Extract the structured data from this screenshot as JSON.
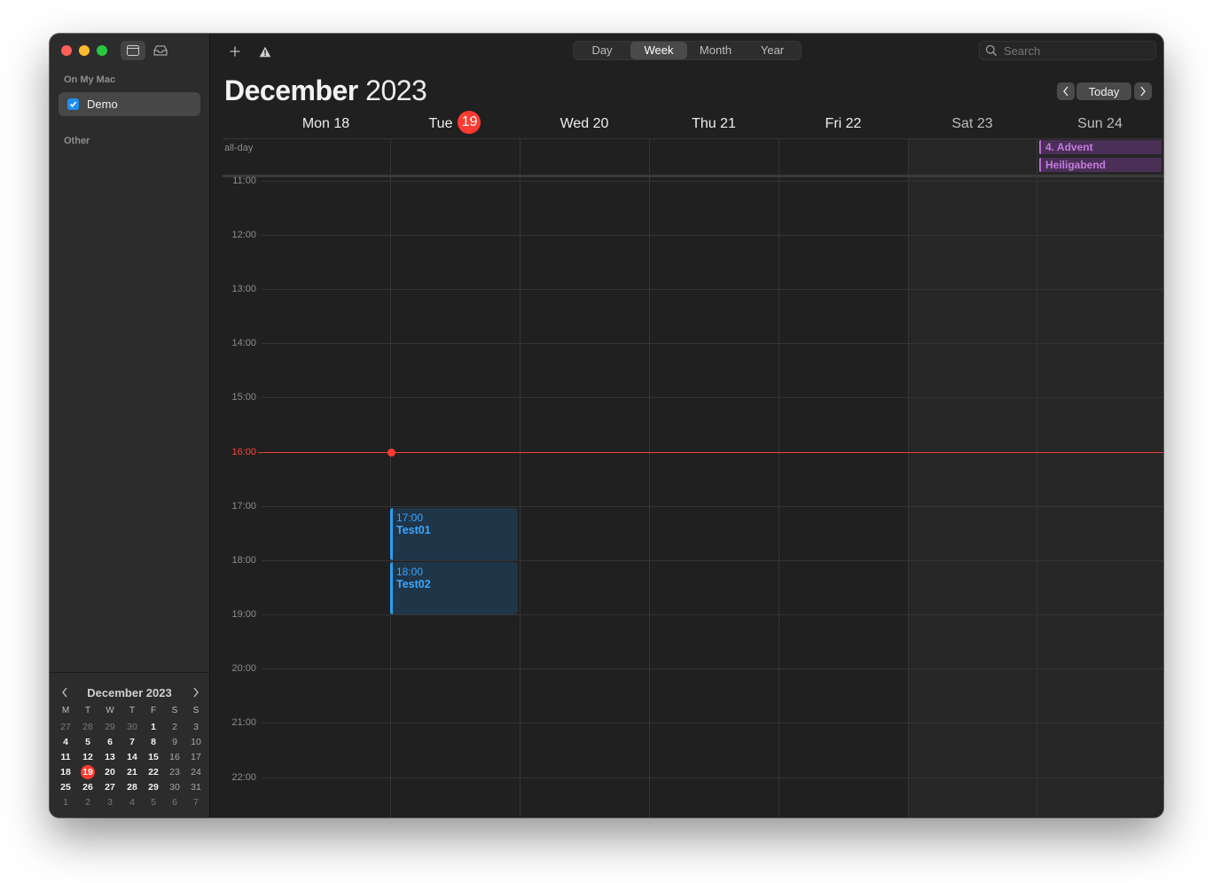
{
  "sidebar": {
    "section_on_my_mac": "On My Mac",
    "calendar_name": "Demo",
    "calendar_checked": true,
    "section_other": "Other"
  },
  "mini_calendar": {
    "title": "December 2023",
    "dow": [
      "M",
      "T",
      "W",
      "T",
      "F",
      "S",
      "S"
    ],
    "weeks": [
      [
        "27",
        "28",
        "29",
        "30",
        "1",
        "2",
        "3"
      ],
      [
        "4",
        "5",
        "6",
        "7",
        "8",
        "9",
        "10"
      ],
      [
        "11",
        "12",
        "13",
        "14",
        "15",
        "16",
        "17"
      ],
      [
        "18",
        "19",
        "20",
        "21",
        "22",
        "23",
        "24"
      ],
      [
        "25",
        "26",
        "27",
        "28",
        "29",
        "30",
        "31"
      ],
      [
        "1",
        "2",
        "3",
        "4",
        "5",
        "6",
        "7"
      ]
    ],
    "today": "19"
  },
  "toolbar": {
    "views": [
      "Day",
      "Week",
      "Month",
      "Year"
    ],
    "active_view": "Week",
    "search_placeholder": "Search",
    "today_label": "Today"
  },
  "header": {
    "month": "December",
    "year": "2023"
  },
  "days": [
    {
      "label": "Mon 18"
    },
    {
      "label": "Tue",
      "number": "19"
    },
    {
      "label": "Wed 20"
    },
    {
      "label": "Thu 21"
    },
    {
      "label": "Fri 22"
    },
    {
      "label": "Sat 23"
    },
    {
      "label": "Sun 24"
    }
  ],
  "allday_label": "all-day",
  "allday_events": [
    {
      "title": "4. Advent",
      "day": "Sun 24"
    },
    {
      "title": "Heiligabend",
      "day": "Sun 24"
    }
  ],
  "hours": [
    "11:00",
    "12:00",
    "13:00",
    "14:00",
    "15:00",
    "16:00",
    "17:00",
    "18:00",
    "19:00",
    "20:00",
    "21:00",
    "22:00"
  ],
  "current_time": "16:00",
  "events": [
    {
      "time": "17:00",
      "title": "Test01",
      "day": "Tue 19"
    },
    {
      "time": "18:00",
      "title": "Test02",
      "day": "Tue 19"
    }
  ],
  "colors": {
    "accent_red": "#ff3b30",
    "event_blue": "#3aa8ff",
    "allday_purple": "#c57be0",
    "checkbox_blue": "#1f8ef1"
  }
}
